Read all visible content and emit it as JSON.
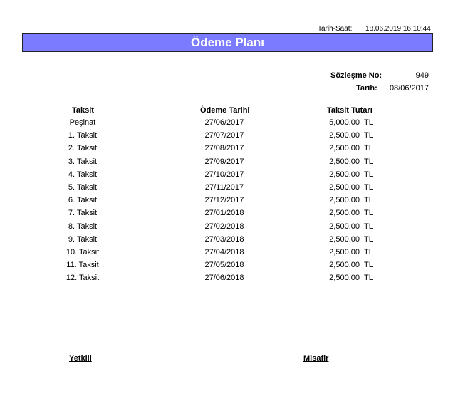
{
  "header": {
    "timestamp_label": "Tarih-Saat:",
    "timestamp_value": "18.06.2019 16:10:44"
  },
  "title": "Ödeme Planı",
  "contract": {
    "number_label": "Sözleşme No:",
    "number_value": "949",
    "date_label": "Tarih:",
    "date_value": "08/06/2017"
  },
  "table": {
    "columns": [
      "Taksit",
      "Ödeme Tarihi",
      "Taksit Tutarı"
    ],
    "currency": "TL",
    "rows": [
      {
        "taksit": "Peşinat",
        "date": "27/06/2017",
        "amount": "5,000.00"
      },
      {
        "taksit": "1. Taksit",
        "date": "27/07/2017",
        "amount": "2,500.00"
      },
      {
        "taksit": "2. Taksit",
        "date": "27/08/2017",
        "amount": "2,500.00"
      },
      {
        "taksit": "3. Taksit",
        "date": "27/09/2017",
        "amount": "2,500.00"
      },
      {
        "taksit": "4. Taksit",
        "date": "27/10/2017",
        "amount": "2,500.00"
      },
      {
        "taksit": "5. Taksit",
        "date": "27/11/2017",
        "amount": "2,500.00"
      },
      {
        "taksit": "6. Taksit",
        "date": "27/12/2017",
        "amount": "2,500.00"
      },
      {
        "taksit": "7. Taksit",
        "date": "27/01/2018",
        "amount": "2,500.00"
      },
      {
        "taksit": "8. Taksit",
        "date": "27/02/2018",
        "amount": "2,500.00"
      },
      {
        "taksit": "9. Taksit",
        "date": "27/03/2018",
        "amount": "2,500.00"
      },
      {
        "taksit": "10. Taksit",
        "date": "27/04/2018",
        "amount": "2,500.00"
      },
      {
        "taksit": "11. Taksit",
        "date": "27/05/2018",
        "amount": "2,500.00"
      },
      {
        "taksit": "12. Taksit",
        "date": "27/06/2018",
        "amount": "2,500.00"
      }
    ]
  },
  "signatures": {
    "left": "Yetkili",
    "right": "Misafir"
  },
  "colors": {
    "title_bar": "#7b7bff",
    "title_text": "#ffffff"
  }
}
